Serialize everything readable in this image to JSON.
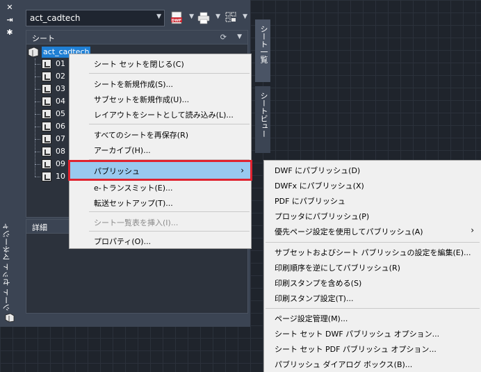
{
  "palette": {
    "vertical_title": "シート セット マネージャ",
    "toolbar": {
      "sheet_set_value": "act_cadtech"
    },
    "sheets_panel": {
      "header": "シート",
      "root_label": "act_cadtech",
      "sheets": [
        "01",
        "02",
        "03",
        "04",
        "05",
        "06",
        "07",
        "08",
        "09",
        "10"
      ]
    },
    "details_panel": {
      "header": "詳細"
    },
    "tabs": {
      "sheet_list": "シート一覧",
      "sheet_view": "シートビュー"
    },
    "icons": {
      "close": "close-icon",
      "autohide": "autohide-icon",
      "properties": "properties-icon",
      "dwf_publish": "dwf-publish-icon",
      "plot": "plot-icon",
      "sheet_selection": "sheet-selection-icon",
      "refresh": "refresh-icon"
    },
    "colors": {
      "palette_bg": "#3b4453",
      "selection": "#1f7fd4",
      "highlight": "#99c9ef",
      "highlight_border": "#e0232f"
    }
  },
  "context_menu": {
    "items": [
      {
        "label": "シート セットを閉じる(C)"
      },
      {
        "label": "シートを新規作成(S)..."
      },
      {
        "label": "サブセットを新規作成(U)..."
      },
      {
        "label": "レイアウトをシートとして読み込み(L)..."
      },
      {
        "label": "すべてのシートを再保存(R)"
      },
      {
        "label": "アーカイブ(H)..."
      },
      {
        "label": "パブリッシュ"
      },
      {
        "label": "e-トランスミット(E)..."
      },
      {
        "label": "転送セットアップ(T)..."
      },
      {
        "label": "シート一覧表を挿入(I)..."
      },
      {
        "label": "プロパティ(O)..."
      }
    ]
  },
  "publish_submenu": {
    "items": [
      {
        "label": "DWF にパブリッシュ(D)"
      },
      {
        "label": "DWFx にパブリッシュ(X)"
      },
      {
        "label": "PDF にパブリッシュ"
      },
      {
        "label": "プロッタにパブリッシュ(P)"
      },
      {
        "label": "優先ページ設定を使用してパブリッシュ(A)"
      },
      {
        "label": "サブセットおよびシート パブリッシュの設定を編集(E)..."
      },
      {
        "label": "印刷順序を逆にしてパブリッシュ(R)"
      },
      {
        "label": "印刷スタンプを含める(S)"
      },
      {
        "label": "印刷スタンプ設定(T)..."
      },
      {
        "label": "ページ設定管理(M)..."
      },
      {
        "label": "シート セット DWF パブリッシュ オプション..."
      },
      {
        "label": "シート セット PDF パブリッシュ オプション..."
      },
      {
        "label": "パブリッシュ ダイアログ ボックス(B)..."
      }
    ]
  }
}
